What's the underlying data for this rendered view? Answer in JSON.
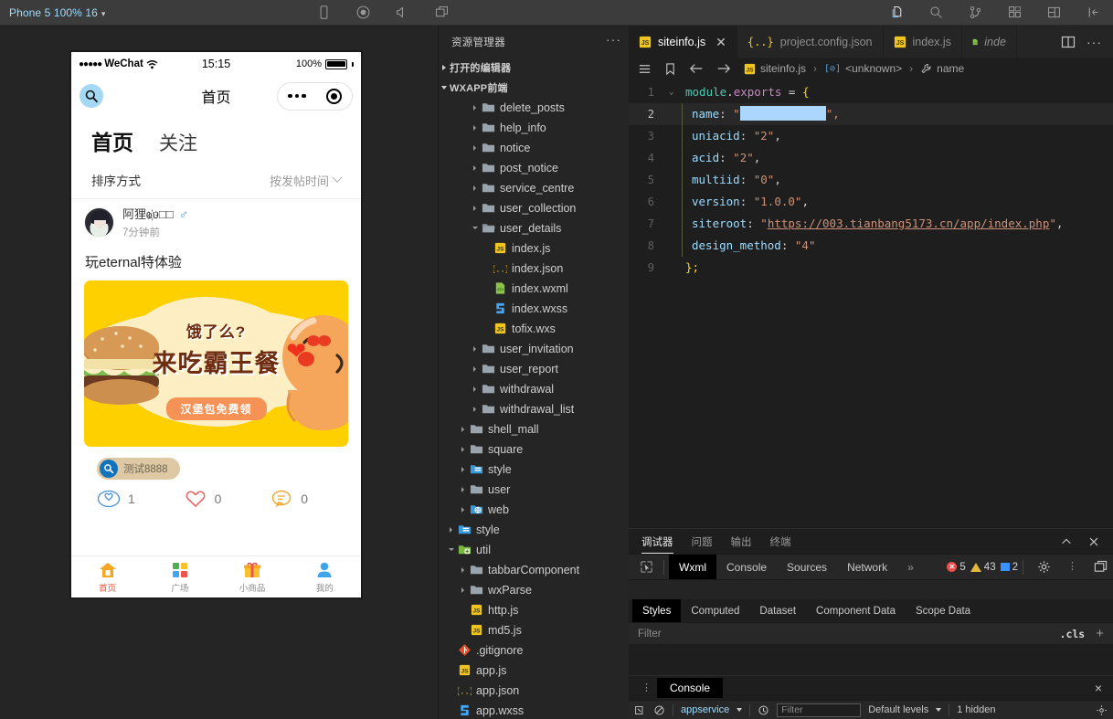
{
  "topbar": {
    "simulator_label": "Phone 5 100% 16",
    "caret": "▾",
    "icons": [
      "phone-frame-icon",
      "record-icon",
      "volume-icon",
      "window-icon"
    ],
    "activity_icons": [
      "files-icon",
      "search-icon",
      "source-control-icon",
      "extensions-icon",
      "layout-icon",
      "collapse-icon"
    ]
  },
  "simulator": {
    "status": {
      "carrier_dots": "●●●●●",
      "carrier": "WeChat",
      "wifi": "wifi-icon",
      "time": "15:15",
      "battery_percent": "100%"
    },
    "nav": {
      "search_icon": "search-icon",
      "title": "首页",
      "capsule_menu": "more-dots-icon",
      "capsule_target": "target-icon"
    },
    "feed_tabs": [
      {
        "label": "首页",
        "active": true
      },
      {
        "label": "关注",
        "active": false
      }
    ],
    "sort": {
      "label": "排序方式",
      "value": "按发帖时间"
    },
    "post": {
      "username": "阿狸ҩ҉ᴜ□□",
      "gender_symbol": "♂",
      "time": "7分钟前",
      "text": "玩eternal特体验",
      "banner": {
        "line1": "饿了么?",
        "line2": "来吃霸王餐",
        "pill": "汉堡包免费领"
      },
      "tag": "测试8888",
      "actions": [
        {
          "icon": "view-icon",
          "count": "1"
        },
        {
          "icon": "heart-icon",
          "count": "0"
        },
        {
          "icon": "comment-icon",
          "count": "0"
        }
      ]
    },
    "tabbar": [
      {
        "label": "首页",
        "icon": "home-icon",
        "active": true
      },
      {
        "label": "广场",
        "icon": "grid-icon",
        "active": false
      },
      {
        "label": "小商品",
        "icon": "gift-icon",
        "active": false
      },
      {
        "label": "我的",
        "icon": "person-icon",
        "active": false
      }
    ]
  },
  "explorer": {
    "title": "资源管理器",
    "more": "···",
    "sections": [
      {
        "label": "打开的编辑器",
        "expanded": false
      },
      {
        "label": "WXAPP前端",
        "expanded": true
      }
    ],
    "tree": [
      {
        "label": "delete_posts",
        "type": "folder",
        "indent": 2,
        "expanded": false
      },
      {
        "label": "help_info",
        "type": "folder",
        "indent": 2,
        "expanded": false
      },
      {
        "label": "notice",
        "type": "folder",
        "indent": 2,
        "expanded": false
      },
      {
        "label": "post_notice",
        "type": "folder",
        "indent": 2,
        "expanded": false
      },
      {
        "label": "service_centre",
        "type": "folder",
        "indent": 2,
        "expanded": false
      },
      {
        "label": "user_collection",
        "type": "folder",
        "indent": 2,
        "expanded": false
      },
      {
        "label": "user_details",
        "type": "folder-open",
        "indent": 2,
        "expanded": true
      },
      {
        "label": "index.js",
        "type": "js",
        "indent": 3
      },
      {
        "label": "index.json",
        "type": "json",
        "indent": 3
      },
      {
        "label": "index.wxml",
        "type": "wxml",
        "indent": 3
      },
      {
        "label": "index.wxss",
        "type": "wxss",
        "indent": 3
      },
      {
        "label": "tofix.wxs",
        "type": "js",
        "indent": 3
      },
      {
        "label": "user_invitation",
        "type": "folder",
        "indent": 2,
        "expanded": false
      },
      {
        "label": "user_report",
        "type": "folder",
        "indent": 2,
        "expanded": false
      },
      {
        "label": "withdrawal",
        "type": "folder",
        "indent": 2,
        "expanded": false
      },
      {
        "label": "withdrawal_list",
        "type": "folder",
        "indent": 2,
        "expanded": false
      },
      {
        "label": "shell_mall",
        "type": "folder",
        "indent": 1,
        "expanded": false
      },
      {
        "label": "square",
        "type": "folder",
        "indent": 1,
        "expanded": false
      },
      {
        "label": "style",
        "type": "folder-style",
        "indent": 1,
        "expanded": false
      },
      {
        "label": "user",
        "type": "folder",
        "indent": 1,
        "expanded": false
      },
      {
        "label": "web",
        "type": "folder-web",
        "indent": 1,
        "expanded": false
      },
      {
        "label": "style",
        "type": "folder-style",
        "indent": 0,
        "expanded": false
      },
      {
        "label": "util",
        "type": "folder-util",
        "indent": 0,
        "expanded": true
      },
      {
        "label": "tabbarComponent",
        "type": "folder",
        "indent": 1,
        "expanded": false
      },
      {
        "label": "wxParse",
        "type": "folder",
        "indent": 1,
        "expanded": false
      },
      {
        "label": "http.js",
        "type": "js",
        "indent": 1
      },
      {
        "label": "md5.js",
        "type": "js",
        "indent": 1
      },
      {
        "label": ".gitignore",
        "type": "git",
        "indent": 0
      },
      {
        "label": "app.js",
        "type": "js",
        "indent": 0
      },
      {
        "label": "app.json",
        "type": "json",
        "indent": 0
      },
      {
        "label": "app.wxss",
        "type": "wxss",
        "indent": 0
      }
    ]
  },
  "editor": {
    "tabs": [
      {
        "label": "siteinfo.js",
        "type": "js",
        "active": true,
        "closable": true
      },
      {
        "label": "project.config.json",
        "type": "json",
        "active": false,
        "closable": false
      },
      {
        "label": "index.js",
        "type": "js",
        "active": false,
        "closable": false
      },
      {
        "label": "inde",
        "type": "wxml",
        "active": false,
        "preview": true
      }
    ],
    "tabs_right": [
      "split-editor-icon",
      "more-actions-icon"
    ],
    "breadcrumb": {
      "nav_icons": [
        "outline-icon",
        "bookmark-icon",
        "back-arrow-icon",
        "forward-arrow-icon"
      ],
      "items": [
        "siteinfo.js",
        "<unknown>",
        "name"
      ],
      "separator": "›"
    },
    "lines": [
      {
        "no": "1",
        "fold": "⌄",
        "highlighted": false
      },
      {
        "no": "2",
        "fold": "",
        "highlighted": true
      },
      {
        "no": "3",
        "fold": "",
        "highlighted": false
      },
      {
        "no": "4",
        "fold": "",
        "highlighted": false
      },
      {
        "no": "5",
        "fold": "",
        "highlighted": false
      },
      {
        "no": "6",
        "fold": "",
        "highlighted": false
      },
      {
        "no": "7",
        "fold": "",
        "highlighted": false
      },
      {
        "no": "8",
        "fold": "",
        "highlighted": false
      },
      {
        "no": "9",
        "fold": "",
        "highlighted": false
      }
    ],
    "code": {
      "l1_module": "module",
      "l1_dot": ".",
      "l1_exports": "exports",
      "l1_eq": " = ",
      "l1_brace": "{",
      "l2_key": "name",
      "l2_colon": ": ",
      "l2_quote": "\"",
      "l2_value": "",
      "l2_end": "\",",
      "l3_key": "uniacid",
      "l3_val": "\"2\"",
      "l4_key": "acid",
      "l4_val": "\"2\"",
      "l5_key": "multiid",
      "l5_val": "\"0\"",
      "l6_key": "version",
      "l6_val": "\"1.0.0\"",
      "l7_key": "siteroot",
      "l7_val": "https://003.tianbang5173.cn/app/index.php",
      "l8_key": "design_method",
      "l8_val": "\"4\"",
      "l9": "};",
      "comma": ","
    }
  },
  "devtools": {
    "panel_tabs": [
      {
        "label": "调试器",
        "active": true
      },
      {
        "label": "问题",
        "active": false
      },
      {
        "label": "输出",
        "active": false
      },
      {
        "label": "终端",
        "active": false
      }
    ],
    "panel_right": [
      "chevron-up-icon",
      "close-icon"
    ],
    "inspector": {
      "picker_icon": "element-picker-icon",
      "tabs": [
        {
          "label": "Wxml",
          "active": true
        },
        {
          "label": "Console",
          "active": false
        },
        {
          "label": "Sources",
          "active": false
        },
        {
          "label": "Network",
          "active": false
        }
      ],
      "overflow": "»",
      "badges": {
        "errors": "5",
        "warnings": "43",
        "info": "2"
      },
      "icons": [
        "gear-icon",
        "kebab-icon",
        "dock-icon"
      ]
    },
    "sub_tabs": [
      {
        "label": "Styles",
        "active": true
      },
      {
        "label": "Computed",
        "active": false
      },
      {
        "label": "Dataset",
        "active": false
      },
      {
        "label": "Component Data",
        "active": false
      },
      {
        "label": "Scope Data",
        "active": false
      }
    ],
    "filter": {
      "placeholder": "Filter",
      "cls": ".cls",
      "add": "+"
    },
    "console": {
      "label": "Console",
      "kebab": "⋮",
      "close": "×",
      "context": "appservice",
      "filter_placeholder": "Filter",
      "levels": "Default levels",
      "hidden": "1 hidden"
    }
  }
}
